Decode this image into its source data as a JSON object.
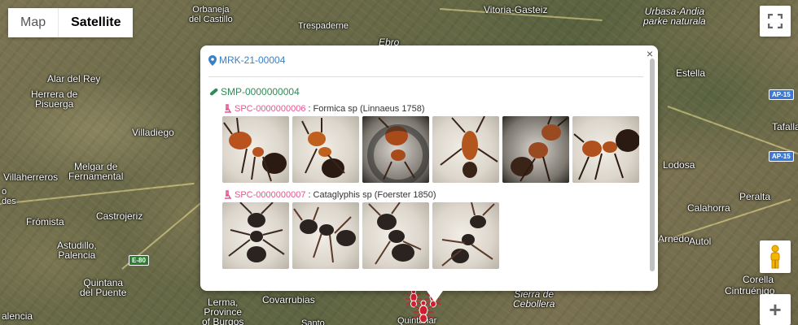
{
  "map": {
    "places": [
      {
        "id": "orbaneja",
        "text": "Orbaneja\ndel Castillo"
      },
      {
        "id": "trespaderne",
        "text": "Trespaderne"
      },
      {
        "id": "vitoria",
        "text": "Vitoria-Gasteiz"
      },
      {
        "id": "urbasa",
        "text": "Urbasa-Andia\nparke naturala"
      },
      {
        "id": "ebro",
        "text": "Ebro"
      },
      {
        "id": "estella",
        "text": "Estella"
      },
      {
        "id": "alar",
        "text": "Alar del Rey"
      },
      {
        "id": "herrera",
        "text": "Herrera de\nPisuerga"
      },
      {
        "id": "villadiego",
        "text": "Villadiego"
      },
      {
        "id": "melgar",
        "text": "Melgar de\nFernamental"
      },
      {
        "id": "villaherreros",
        "text": "Villaherreros"
      },
      {
        "id": "des",
        "text": "o\ndes"
      },
      {
        "id": "fromista",
        "text": "Frómista"
      },
      {
        "id": "castrojeriz",
        "text": "Castrojeriz"
      },
      {
        "id": "astudillo",
        "text": "Astudillo,\nPalencia"
      },
      {
        "id": "quintana",
        "text": "Quintana\ndel Puente"
      },
      {
        "id": "alencia",
        "text": "alencia"
      },
      {
        "id": "lerma",
        "text": "Lerma,\nProvince\nof Burgos"
      },
      {
        "id": "covarrubias",
        "text": "Covarrubias"
      },
      {
        "id": "quintanar",
        "text": "Quintanar"
      },
      {
        "id": "cebollera",
        "text": "Sierra de\nCebollera"
      },
      {
        "id": "tafalla",
        "text": "Tafalla"
      },
      {
        "id": "lodosa",
        "text": "Lodosa"
      },
      {
        "id": "peralta",
        "text": "Peralta"
      },
      {
        "id": "calahorra",
        "text": "Calahorra"
      },
      {
        "id": "arnedo",
        "text": "Arnedo"
      },
      {
        "id": "autol",
        "text": "Autol"
      },
      {
        "id": "corella",
        "text": "Corella"
      },
      {
        "id": "cintruenigo",
        "text": "Cintruénigo"
      },
      {
        "id": "santo",
        "text": "Santo"
      }
    ],
    "highways": {
      "ap15a": "AP-15",
      "ap15b": "AP-15",
      "e80": "E-80"
    }
  },
  "map_type": {
    "map_label": "Map",
    "satellite_label": "Satellite",
    "selected": "Satellite"
  },
  "controls": {
    "fullscreen_icon": "fullscreen-icon",
    "street_view_icon": "pegman-icon",
    "zoom_in_label": "+"
  },
  "info_window": {
    "close_label": "×",
    "marker": {
      "icon": "map-pin-icon",
      "code": "MRK-21-00004"
    },
    "sample": {
      "icon": "test-tube-icon",
      "code": "SMP-0000000004"
    },
    "specimens": [
      {
        "icon": "microscope-icon",
        "code": "SPC-0000000006",
        "separator": ":",
        "taxon": " Formica sp (Linnaeus 1758)",
        "photo_count": 6
      },
      {
        "icon": "microscope-icon",
        "code": "SPC-0000000007",
        "separator": ":",
        "taxon": " Cataglyphis sp (Foerster 1850)",
        "photo_count": 4
      }
    ]
  },
  "colors": {
    "marker_link": "#3b7fc4",
    "sample_link": "#2e8b57",
    "specimen_link": "#e7548f",
    "ant_marker": "#d01f2f"
  }
}
